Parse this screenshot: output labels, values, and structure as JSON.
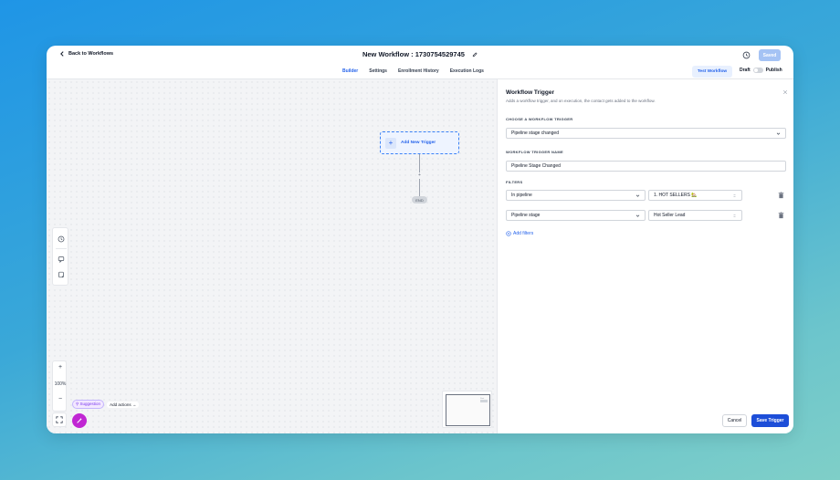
{
  "header": {
    "back_label": "Back to Workflows",
    "workflow_title": "New Workflow : 1730754529745",
    "saved_label": "Saved"
  },
  "tabs": [
    {
      "label": "Builder",
      "active": true
    },
    {
      "label": "Settings",
      "active": false
    },
    {
      "label": "Enrollment History",
      "active": false
    },
    {
      "label": "Execution Logs",
      "active": false
    }
  ],
  "toolbar": {
    "test_label": "Test Workflow",
    "draft_label": "Draft",
    "publish_label": "Publish"
  },
  "canvas": {
    "add_trigger_label": "Add New Trigger",
    "connector_plus": "+",
    "end_label": "END",
    "zoom_level": "100%",
    "zoom_in": "+",
    "zoom_out": "−",
    "suggestion_label": "Suggestion",
    "add_actions_label": "Add actions",
    "minimap_label": "Start"
  },
  "panel": {
    "title": "Workflow Trigger",
    "subtitle": "Adds a workflow trigger, and on execution, the contact gets added to the workflow.",
    "choose_label": "CHOOSE A WORKFLOW TRIGGER",
    "trigger_value": "Pipeline stage changed",
    "name_label": "WORKFLOW TRIGGER NAME",
    "name_value": "Pipeline Stage Changed",
    "filters_label": "FILTERS",
    "filters": [
      {
        "field": "In pipeline",
        "value": "1. HOT SELLERS 🏡"
      },
      {
        "field": "Pipeline stage",
        "value": "Hot Seller Lead"
      }
    ],
    "add_filters_label": "Add filters",
    "cancel_label": "Cancel",
    "save_label": "Save Trigger"
  },
  "colors": {
    "accent": "#2563eb",
    "save_button": "#1d4ed8",
    "saved_button": "#a5c3f4",
    "wand": "#c026d3"
  }
}
